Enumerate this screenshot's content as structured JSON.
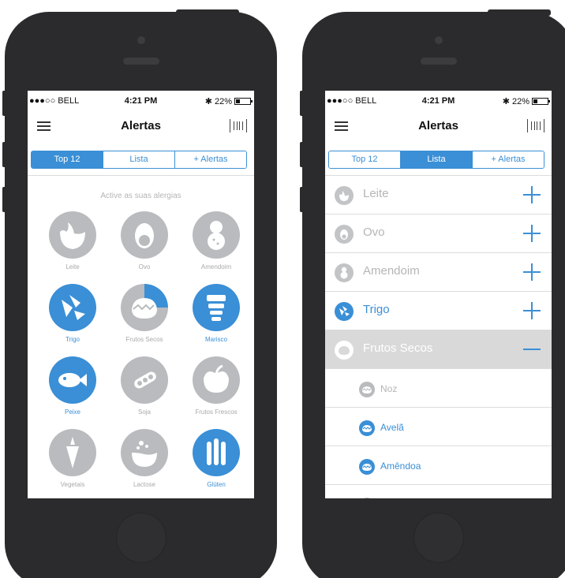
{
  "status_bar": {
    "carrier": "●●●○○ BELL ",
    "time": "4:21 PM",
    "battery": "22%",
    "bluetooth_icon": "✱"
  },
  "navbar": {
    "title": "Alertas",
    "menu_icon": "hamburger-icon",
    "scan_icon": "barcode-icon"
  },
  "tabs": [
    "Top 12",
    "Lista",
    "+ Alertas"
  ],
  "screen1": {
    "active_tab": "Top 12",
    "hint": "Active as suas alergias",
    "allergens": [
      {
        "label": "Leite",
        "active": false
      },
      {
        "label": "Ovo",
        "active": false
      },
      {
        "label": "Amendoim",
        "active": false
      },
      {
        "label": "Trigo",
        "active": true
      },
      {
        "label": "Frutos Secos",
        "active": false,
        "partial": true
      },
      {
        "label": "Marisco",
        "active": true
      },
      {
        "label": "Peixe",
        "active": true
      },
      {
        "label": "Soja",
        "active": false
      },
      {
        "label": "Frutos Frescos",
        "active": false
      },
      {
        "label": "Vegetais",
        "active": false
      },
      {
        "label": "Lactose",
        "active": false
      },
      {
        "label": "Glúten",
        "active": true
      }
    ]
  },
  "screen2": {
    "active_tab": "Lista",
    "rows": [
      {
        "label": "Leite",
        "active": false
      },
      {
        "label": "Ovo",
        "active": false
      },
      {
        "label": "Amendoim",
        "active": false
      },
      {
        "label": "Trigo",
        "active": true
      },
      {
        "label": "Frutos Secos",
        "expanded": true
      }
    ],
    "sub_rows": [
      {
        "label": "Noz",
        "active": false
      },
      {
        "label": "Avelã",
        "active": true
      },
      {
        "label": "Amêndoa",
        "active": true
      }
    ]
  },
  "colors": {
    "accent": "#3a8fd6",
    "inactive": "#b9bbbe",
    "phone": "#2b2b2d"
  }
}
